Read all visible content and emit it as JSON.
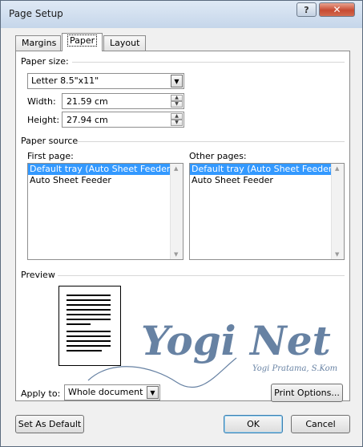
{
  "window": {
    "title": "Page Setup",
    "help_label": "?",
    "close_label": "✕"
  },
  "tabs": [
    {
      "label": "Margins",
      "selected": false
    },
    {
      "label": "Paper",
      "selected": true
    },
    {
      "label": "Layout",
      "selected": false
    }
  ],
  "paper_size": {
    "group_label": "Paper size:",
    "selected": "Letter 8.5\"x11\"",
    "width_label": "Width:",
    "width_value": "21.59 cm",
    "height_label": "Height:",
    "height_value": "27.94 cm"
  },
  "paper_source": {
    "group_label": "Paper source",
    "first_page_label": "First page:",
    "first_page_items": [
      "Default tray (Auto Sheet Feeder)",
      "Auto Sheet Feeder"
    ],
    "other_pages_label": "Other pages:",
    "other_pages_items": [
      "Default tray (Auto Sheet Feeder)",
      "Auto Sheet Feeder"
    ]
  },
  "preview": {
    "group_label": "Preview"
  },
  "watermark": {
    "main": "Yogi Net",
    "sub": "Yogi Pratama, S.Kom"
  },
  "apply_to": {
    "label": "Apply to:",
    "selected": "Whole document"
  },
  "buttons": {
    "print_options": "Print Options...",
    "set_as_default": "Set As Default",
    "ok": "OK",
    "cancel": "Cancel"
  },
  "colors": {
    "selection": "#3399ff",
    "close_button": "#c74b32",
    "watermark": "#3d5f8a"
  }
}
